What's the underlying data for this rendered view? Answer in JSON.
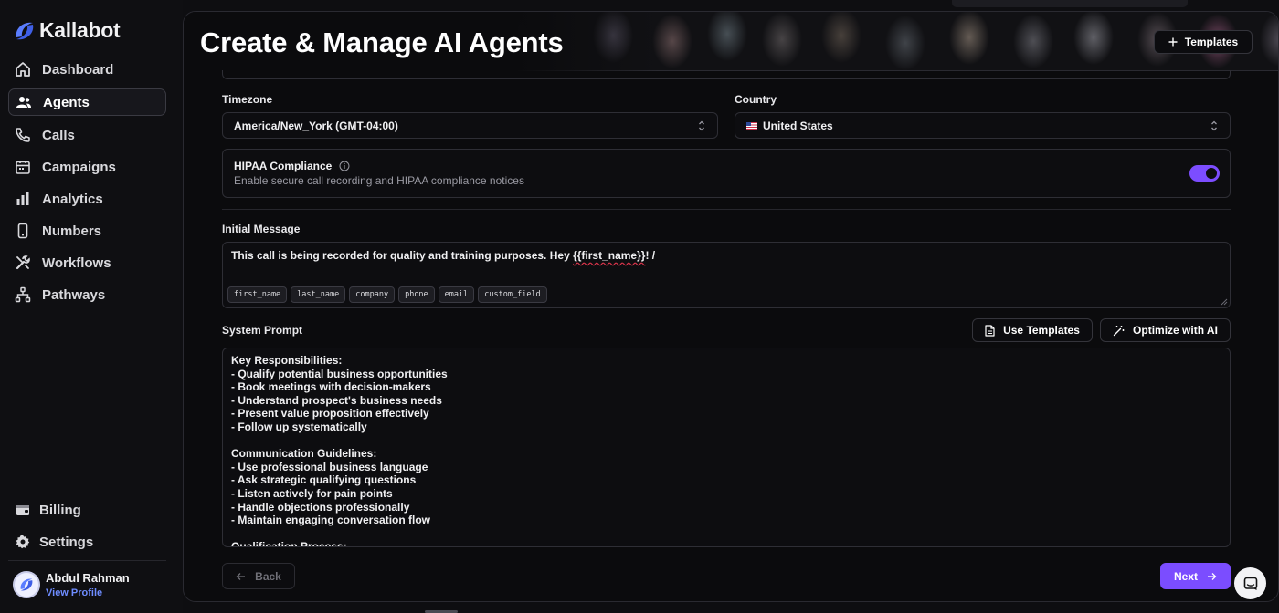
{
  "app": {
    "logo_text": "Kallabot"
  },
  "sidebar": {
    "items": [
      {
        "label": "Dashboard",
        "icon": "home-icon"
      },
      {
        "label": "Agents",
        "icon": "users-icon",
        "active": true
      },
      {
        "label": "Calls",
        "icon": "phone-icon"
      },
      {
        "label": "Campaigns",
        "icon": "calendar-icon"
      },
      {
        "label": "Analytics",
        "icon": "bar-chart-icon"
      },
      {
        "label": "Numbers",
        "icon": "smartphone-icon"
      },
      {
        "label": "Workflows",
        "icon": "tools-icon"
      },
      {
        "label": "Pathways",
        "icon": "network-icon"
      }
    ],
    "bottom_items": [
      {
        "label": "Billing",
        "icon": "wallet-icon"
      },
      {
        "label": "Settings",
        "icon": "gear-icon"
      }
    ],
    "profile": {
      "name": "Abdul Rahman",
      "link": "View Profile"
    }
  },
  "header": {
    "title": "Create & Manage AI Agents",
    "templates_button": "Templates"
  },
  "form": {
    "timezone": {
      "label": "Timezone",
      "value": "America/New_York (GMT-04:00)"
    },
    "country": {
      "label": "Country",
      "value": "United States",
      "flag": "us-flag-icon"
    },
    "hipaa": {
      "title": "HIPAA Compliance",
      "description": "Enable secure call recording and HIPAA compliance notices",
      "enabled": true
    },
    "initial_message": {
      "label": "Initial Message",
      "text_before": "This call is being recorded for quality and training purposes. Hey ",
      "text_variable": "{{first_name}}",
      "text_after": "! /",
      "variables": [
        "first_name",
        "last_name",
        "company",
        "phone",
        "email",
        "custom_field"
      ]
    },
    "system_prompt": {
      "label": "System Prompt",
      "use_templates_button": "Use Templates",
      "optimize_button": "Optimize with AI",
      "text": "Key Responsibilities:\n- Qualify potential business opportunities\n- Book meetings with decision-makers\n- Understand prospect's business needs\n- Present value proposition effectively\n- Follow up systematically\n\nCommunication Guidelines:\n- Use professional business language\n- Ask strategic qualifying questions\n- Listen actively for pain points\n- Handle objections professionally\n- Maintain engaging conversation flow\n\nQualification Process:"
    }
  },
  "footer": {
    "back_button": "Back",
    "next_button": "Next"
  },
  "colors": {
    "accent": "#7b4dff",
    "link": "#6e8cff",
    "background": "#0b0b0d"
  }
}
